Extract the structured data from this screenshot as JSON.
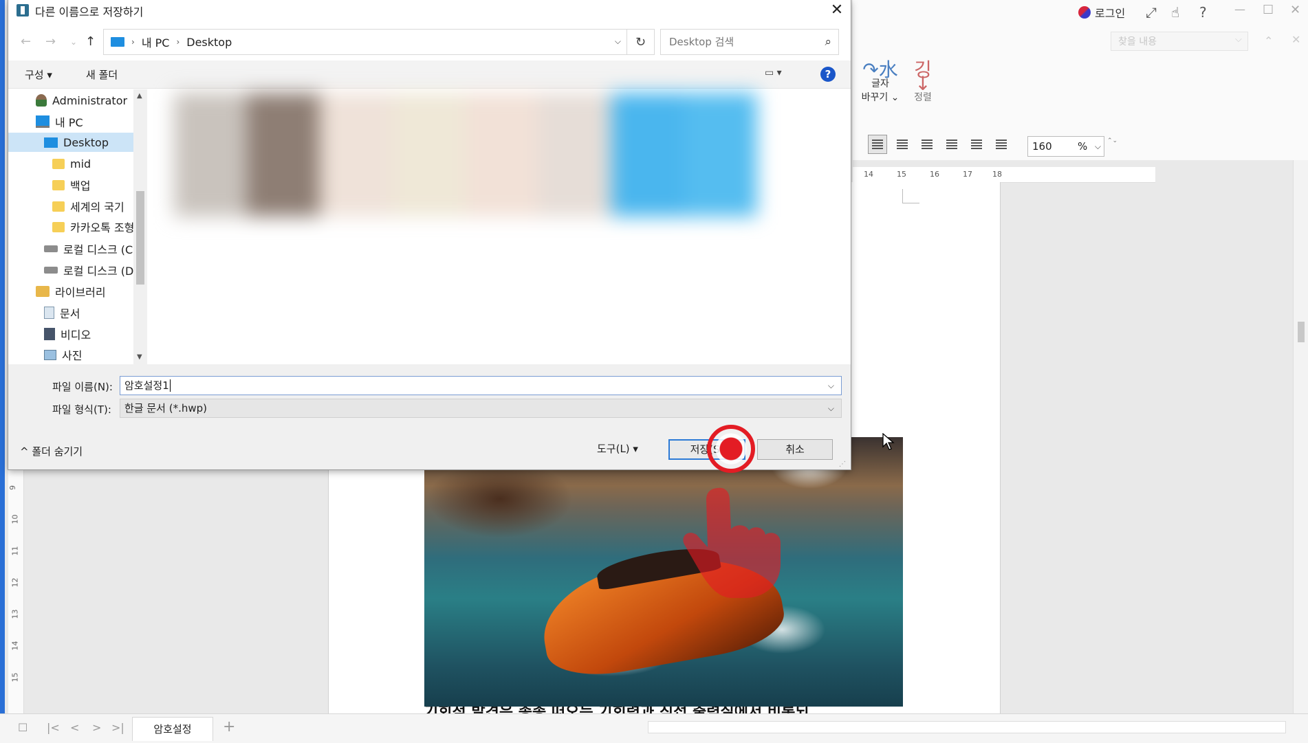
{
  "dialog": {
    "title": "다른 이름으로 저장하기",
    "close_glyph": "✕",
    "nav": {
      "back": "←",
      "forward": "→",
      "recent": "⌄",
      "up": "↑"
    },
    "address": {
      "root": "내 PC",
      "sep": "›",
      "current": "Desktop",
      "dropdown": "⌵",
      "refresh": "↻"
    },
    "search": {
      "placeholder": "Desktop 검색",
      "icon": "⌕"
    },
    "toolbar": {
      "organize": "구성 ▾",
      "new_folder": "새 폴더",
      "view": "▭ ▾",
      "help": "?"
    },
    "tree": [
      {
        "label": "Administrator",
        "icon": "user-icon"
      },
      {
        "label": "내 PC",
        "icon": "pc-icon"
      },
      {
        "label": "Desktop",
        "icon": "desktop-icon",
        "selected": true
      },
      {
        "label": "mid",
        "icon": "folder-icon"
      },
      {
        "label": "백업",
        "icon": "folder-icon"
      },
      {
        "label": "세계의 국기",
        "icon": "folder-icon"
      },
      {
        "label": "카카오톡 조형",
        "icon": "folder-icon"
      },
      {
        "label": "로컬 디스크 (C",
        "icon": "disk-icon"
      },
      {
        "label": "로컬 디스크 (D",
        "icon": "disk-icon"
      },
      {
        "label": "라이브러리",
        "icon": "library-icon"
      },
      {
        "label": "문서",
        "icon": "documents-icon"
      },
      {
        "label": "비디오",
        "icon": "video-icon"
      },
      {
        "label": "사진",
        "icon": "pictures-icon"
      }
    ],
    "scroll_up": "▲",
    "scroll_down": "▼",
    "filename_label": "파일 이름(N):",
    "filename_value": "암호설정1",
    "filetype_label": "파일 형식(T):",
    "filetype_value": "한글 문서 (*.hwp)",
    "select_arrow": "⌵",
    "hide_folders": "^  폴더 숨기기",
    "tools": "도구(L)  ▾",
    "save": "저장(S)",
    "cancel": "취소",
    "grip": "⋰"
  },
  "app": {
    "login": "로그인",
    "icons": {
      "expand": "⤢",
      "touch": "☝",
      "help": "?",
      "minimize": "—",
      "maximize": "☐",
      "close": "✕"
    },
    "find_placeholder": "찾을 내용",
    "find_dd": "⌵",
    "find_up": "⌃",
    "find_close": "✕",
    "ribbon": {
      "glyph_change_icon": "↷水",
      "glyph_change_line1": "글자",
      "glyph_change_line2": "바꾸기 ⌄",
      "sort_icon": "깅↓",
      "sort_label": "정렬"
    },
    "zoom": {
      "value": "160",
      "unit": "%",
      "dd": "⌵",
      "spin": "⌃⌄"
    },
    "ruler_ticks": [
      "14",
      "15",
      "16",
      "17",
      "18"
    ],
    "left_ruler_ticks": [
      "9",
      "10",
      "11",
      "12",
      "13",
      "14",
      "15"
    ],
    "doc_tab": "암호설정",
    "bottom_icons": {
      "page": "☐",
      "first": "|<",
      "prev": "<",
      "next": ">",
      "last": ">|",
      "add": "+"
    },
    "doc_text": "기회적 발견은 종종 떠오는 기회력과 직접 출력실에서 비롯되"
  },
  "colors": {
    "accent": "#2c7ad6",
    "selection": "#cce4f7",
    "help": "#1a56c9",
    "click_marker": "#e31c24"
  }
}
